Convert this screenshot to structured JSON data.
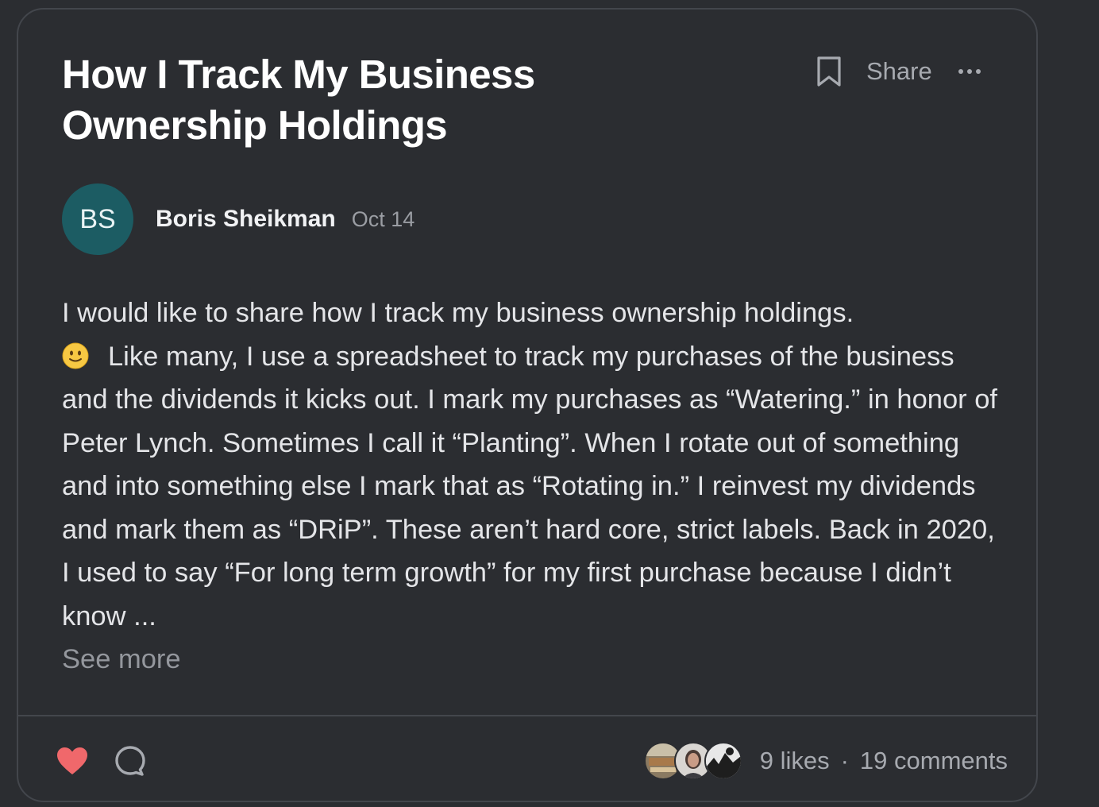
{
  "post": {
    "title": "How I Track My Business Ownership Holdings",
    "share_label": "Share",
    "author": {
      "initials": "BS",
      "name": "Boris Sheikman",
      "date": "Oct 14"
    },
    "body": {
      "line1": "I would like to share how I track my business ownership holdings.",
      "emoji": "slightly-smiling-face-icon",
      "rest": "Like many, I use a spreadsheet to track my purchases of the business and the dividends it kicks out. I mark my purchases as “Watering.” in honor of Peter Lynch. Sometimes I call it “Planting”. When I rotate out of something and into something else I mark that as “Rotating in.” I reinvest my dividends and mark them as “DRiP”. These aren’t hard core, strict labels. Back in 2020, I used to say “For long term growth” for my first purchase because I didn’t know ..."
    },
    "see_more": "See more"
  },
  "footer": {
    "likes": "9 likes",
    "separator": "·",
    "comments": "19 comments"
  },
  "colors": {
    "background": "#2b2d31",
    "border": "#43464c",
    "avatar": "#1c5c63",
    "heart": "#f0686b",
    "muted": "#a7aab0"
  },
  "icons": [
    "bookmark-icon",
    "more-icon",
    "heart-icon",
    "comment-icon",
    "slightly-smiling-face-icon"
  ]
}
